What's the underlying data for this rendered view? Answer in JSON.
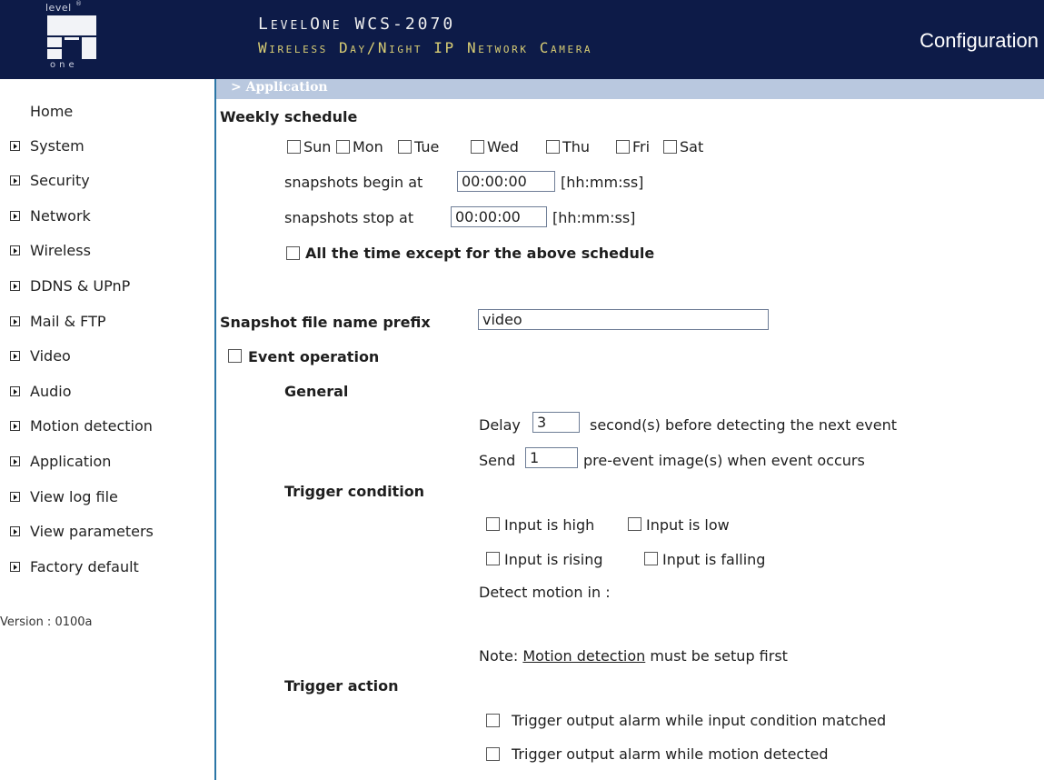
{
  "header": {
    "logo_top": "level",
    "logo_sup": "®",
    "logo_bottom": "one",
    "brand": "LevelOne WCS-2070",
    "subtitle": "Wireless Day/Night IP Network Camera",
    "title": "Configuration"
  },
  "sidebar": {
    "home": "Home",
    "items": [
      {
        "label": "System"
      },
      {
        "label": "Security"
      },
      {
        "label": "Network"
      },
      {
        "label": "Wireless"
      },
      {
        "label": "DDNS & UPnP"
      },
      {
        "label": "Mail & FTP"
      },
      {
        "label": "Video"
      },
      {
        "label": "Audio"
      },
      {
        "label": "Motion detection"
      },
      {
        "label": "Application"
      },
      {
        "label": "View log file"
      },
      {
        "label": "View parameters"
      },
      {
        "label": "Factory default"
      }
    ],
    "version": "Version : 0100a"
  },
  "breadcrumb": "> Application",
  "weekly": {
    "heading": "Weekly schedule",
    "days": [
      "Sun",
      "Mon",
      "Tue",
      "Wed",
      "Thu",
      "Fri",
      "Sat"
    ],
    "begin_label": "snapshots begin at",
    "begin_value": "00:00:00",
    "stop_label": "snapshots stop at",
    "stop_value": "00:00:00",
    "time_format": "[hh:mm:ss]",
    "except_label": "All the time except for the above schedule"
  },
  "prefix": {
    "label": "Snapshot file name prefix",
    "value": "video"
  },
  "event": {
    "label": "Event operation",
    "general": "General",
    "delay_label": "Delay",
    "delay_value": "3",
    "delay_suffix": "second(s) before detecting the next event",
    "send_label": "Send",
    "send_value": "1",
    "send_suffix": "pre-event image(s) when event occurs",
    "trigger_condition": "Trigger condition",
    "input_high": "Input is high",
    "input_low": "Input is low",
    "input_rising": "Input is rising",
    "input_falling": "Input is falling",
    "detect_motion": "Detect motion in :",
    "note_prefix": "Note: ",
    "note_link": "Motion detection",
    "note_suffix": " must be setup first",
    "trigger_action": "Trigger action",
    "action_input": "Trigger output alarm while input condition matched",
    "action_motion": "Trigger output alarm while motion detected"
  },
  "colors": {
    "header_bg": "#0d1b48",
    "subtitle": "#d8cd74",
    "breadcrumb_bar": "#b9c8df",
    "sidebar_border": "#2b76a6"
  }
}
